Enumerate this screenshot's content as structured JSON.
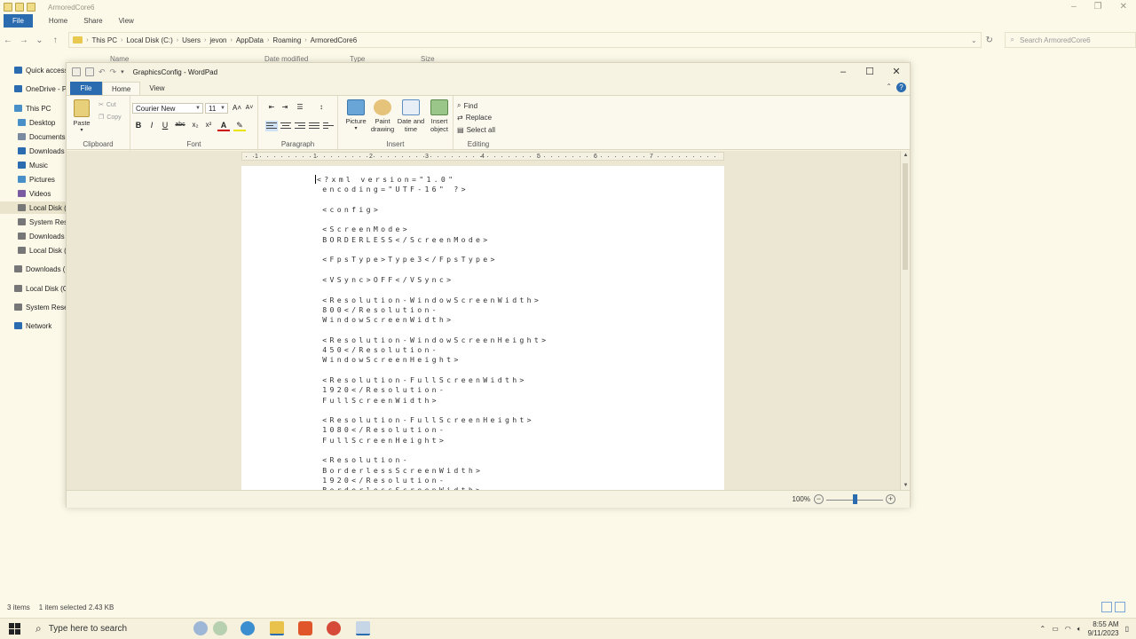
{
  "explorer": {
    "title": "ArmoredCore6",
    "tabs": {
      "file": "File",
      "home": "Home",
      "share": "Share",
      "view": "View"
    },
    "breadcrumbs": [
      "This PC",
      "Local Disk (C:)",
      "Users",
      "jevon",
      "AppData",
      "Roaming",
      "ArmoredCore6"
    ],
    "search_placeholder": "Search ArmoredCore6",
    "columns": {
      "name": "Name",
      "date": "Date modified",
      "type": "Type",
      "size": "Size"
    },
    "nav": [
      {
        "label": "Quick access",
        "icon": "star-icon",
        "color": "#2b6cb0"
      },
      {
        "label": "OneDrive - P",
        "icon": "cloud-icon",
        "color": "#2b6cb0"
      },
      {
        "label": "This PC",
        "icon": "computer-icon",
        "color": "#4a90c8"
      },
      {
        "label": "Desktop",
        "icon": "desktop-icon",
        "color": "#4a90c8"
      },
      {
        "label": "Documents",
        "icon": "documents-icon",
        "color": "#7a8aa0"
      },
      {
        "label": "Downloads",
        "icon": "download-icon",
        "color": "#2b6cb0"
      },
      {
        "label": "Music",
        "icon": "music-icon",
        "color": "#2b6cb0"
      },
      {
        "label": "Pictures",
        "icon": "pictures-icon",
        "color": "#4a90c8"
      },
      {
        "label": "Videos",
        "icon": "videos-icon",
        "color": "#7a5aa0"
      },
      {
        "label": "Local Disk (C",
        "icon": "drive-icon",
        "color": "#777"
      },
      {
        "label": "System Rese",
        "icon": "drive-icon",
        "color": "#777"
      },
      {
        "label": "Downloads (",
        "icon": "drive-icon",
        "color": "#777"
      },
      {
        "label": "Local Disk (G",
        "icon": "drive-icon",
        "color": "#777"
      },
      {
        "label": "Downloads (",
        "icon": "drive-icon",
        "color": "#777"
      },
      {
        "label": "Local Disk (G",
        "icon": "drive-icon",
        "color": "#777"
      },
      {
        "label": "System Rese",
        "icon": "drive-icon",
        "color": "#777"
      },
      {
        "label": "Network",
        "icon": "network-icon",
        "color": "#2b6cb0"
      }
    ],
    "status": {
      "items": "3 items",
      "selected": "1 item selected  2.43 KB"
    }
  },
  "wordpad": {
    "title": "GraphicsConfig - WordPad",
    "tabs": {
      "file": "File",
      "home": "Home",
      "view": "View"
    },
    "ribbon": {
      "clipboard": {
        "label": "Clipboard",
        "paste": "Paste",
        "cut": "Cut",
        "copy": "Copy"
      },
      "font": {
        "label": "Font",
        "family": "Courier New",
        "size": "11",
        "bold": "B",
        "italic": "I",
        "underline": "U",
        "strike": "abc",
        "subscript": "x₂",
        "superscript": "x²"
      },
      "paragraph": {
        "label": "Paragraph"
      },
      "insert": {
        "label": "Insert",
        "picture": "Picture",
        "paint": "Paint drawing",
        "datetime": "Date and time",
        "object": "Insert object"
      },
      "editing": {
        "label": "Editing",
        "find": "Find",
        "replace": "Replace",
        "select_all": "Select all"
      }
    },
    "ruler_numbers": [
      "1",
      "1",
      "2",
      "3",
      "4",
      "5",
      "6",
      "7"
    ],
    "document_lines": [
      "<?xml version=\"1.0\"",
      " encoding=\"UTF-16\" ?>",
      "",
      " <config>",
      "",
      " <ScreenMode>",
      " BORDERLESS</ScreenMode>",
      "",
      " <FpsType>Type3</FpsType>",
      "",
      " <VSync>OFF</VSync>",
      "",
      " <Resolution-WindowScreenWidth>",
      " 800</Resolution-",
      " WindowScreenWidth>",
      "",
      " <Resolution-WindowScreenHeight>",
      " 450</Resolution-",
      " WindowScreenHeight>",
      "",
      " <Resolution-FullScreenWidth>",
      " 1920</Resolution-",
      " FullScreenWidth>",
      "",
      " <Resolution-FullScreenHeight>",
      " 1080</Resolution-",
      " FullScreenHeight>",
      "",
      " <Resolution-",
      " BorderlessScreenWidth>",
      " 1920</Resolution-",
      " BorderlessScreenWidth>"
    ],
    "zoom": {
      "label": "100%",
      "level": 100
    }
  },
  "taskbar": {
    "search_placeholder": "Type here to search",
    "time": "8:55 AM",
    "date": "9/11/2023"
  }
}
